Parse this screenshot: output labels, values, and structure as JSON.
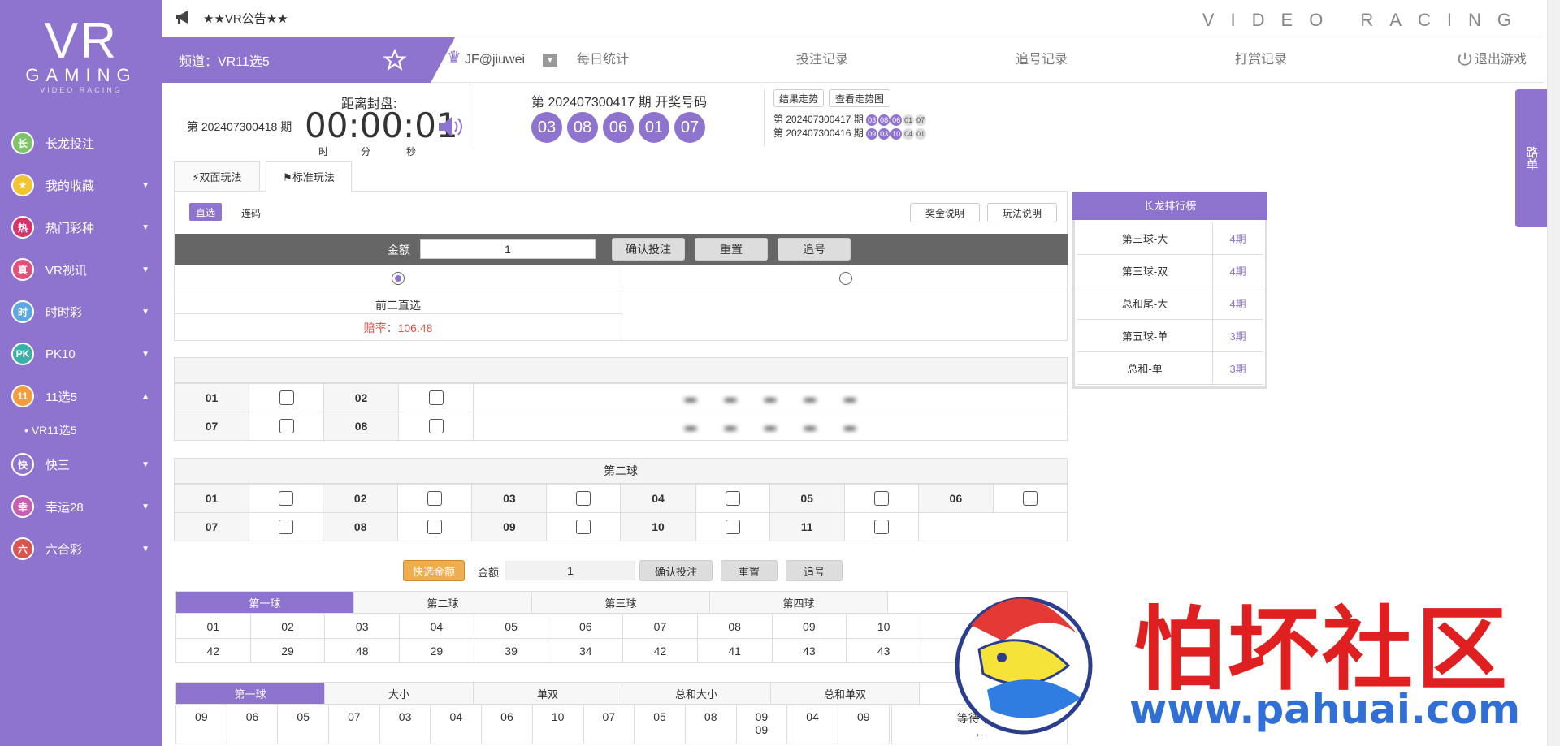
{
  "brand": {
    "logo_main": "VR",
    "logo_sub": "GAMING",
    "logo_tag": "VIDEO RACING",
    "header_right": "VIDEO RACING"
  },
  "announcement": "★★VR公告★★",
  "sidebar": {
    "items": [
      {
        "icon": "长",
        "label": "长龙投注",
        "arrow": "",
        "iconbg": "#7cc36a"
      },
      {
        "icon": "★",
        "label": "我的收藏",
        "arrow": "▼",
        "iconbg": "#f4c430"
      },
      {
        "icon": "热",
        "label": "热门彩种",
        "arrow": "▼",
        "iconbg": "#d6336c"
      },
      {
        "icon": "真",
        "label": "VR视讯",
        "arrow": "▼",
        "iconbg": "#e0507a"
      },
      {
        "icon": "时",
        "label": "时时彩",
        "arrow": "▼",
        "iconbg": "#5aa9e6"
      },
      {
        "icon": "PK",
        "label": "PK10",
        "arrow": "▼",
        "iconbg": "#35b3a6"
      },
      {
        "icon": "11",
        "label": "11选5",
        "arrow": "▲",
        "iconbg": "#f39c3c"
      }
    ],
    "sub_item": "• VR11选5",
    "items2": [
      {
        "icon": "快",
        "label": "快三",
        "arrow": "▼",
        "iconbg": "#8e73cf"
      },
      {
        "icon": "幸",
        "label": "幸运28",
        "arrow": "▼",
        "iconbg": "#c55fb0"
      },
      {
        "icon": "六",
        "label": "六合彩",
        "arrow": "▼",
        "iconbg": "#d9534f"
      }
    ]
  },
  "topbar": {
    "channel": "频道：VR11选5",
    "user": "JF@jiuwei",
    "links": [
      "每日统计",
      "投注记录",
      "追号记录",
      "打赏记录"
    ],
    "logout": "退出游戏"
  },
  "draw": {
    "current_period": "第 202407300418 期",
    "countdown_label": "距离封盘:",
    "countdown": "00:00:01",
    "units": [
      "时",
      "分",
      "秒"
    ],
    "last_label": "第 202407300417 期 开奖号码",
    "last_balls": [
      "03",
      "08",
      "06",
      "01",
      "07"
    ],
    "trend_btn": "结果走势",
    "chart_btn": "查看走势图",
    "history": [
      {
        "period": "第 202407300417 期",
        "balls": [
          "03",
          "08",
          "06",
          "01",
          "07"
        ]
      },
      {
        "period": "第 202407300416 期",
        "balls": [
          "09",
          "03",
          "10",
          "04",
          "01"
        ]
      }
    ]
  },
  "tabs": [
    "⚡双面玩法",
    "⚑标准玩法"
  ],
  "modes": [
    "直选",
    "连码"
  ],
  "help_buttons": [
    "奖金说明",
    "玩法说明"
  ],
  "betbar": {
    "amount_label": "金额",
    "amount": "1",
    "confirm": "确认投注",
    "reset": "重置",
    "chase": "追号"
  },
  "option": {
    "name": "前二直选",
    "odds": "赔率：106.48"
  },
  "ball_nums_row1": [
    "01",
    "02"
  ],
  "ball_nums_row2": [
    "07",
    "08"
  ],
  "second_ball": {
    "title": "第二球",
    "row1": [
      "01",
      "02",
      "03",
      "04",
      "05",
      "06"
    ],
    "row2": [
      "07",
      "08",
      "09",
      "10",
      "11"
    ]
  },
  "betbar2": {
    "quick": "快选金额",
    "amount_label": "金额",
    "amount": "1",
    "confirm": "确认投注",
    "reset": "重置",
    "chase": "追号"
  },
  "stats": {
    "tabs": [
      "第一球",
      "第二球",
      "第三球",
      "第四球"
    ],
    "nums": [
      "01",
      "02",
      "03",
      "04",
      "05",
      "06",
      "07",
      "08",
      "09",
      "10"
    ],
    "counts": [
      "42",
      "29",
      "48",
      "29",
      "39",
      "34",
      "42",
      "41",
      "43",
      "43"
    ]
  },
  "road": {
    "tabs": [
      "第一球",
      "大小",
      "单双",
      "总和大小",
      "总和单双"
    ],
    "row1": [
      "09",
      "06",
      "05",
      "07",
      "03",
      "04",
      "06",
      "10",
      "07",
      "05",
      "08",
      "09",
      "04",
      "09"
    ],
    "row1b": "09",
    "waiting": "等待下期",
    "arrow": "←"
  },
  "rank": {
    "title": "长龙排行榜",
    "rows": [
      {
        "name": "第三球-大",
        "val": "4期"
      },
      {
        "name": "第三球-双",
        "val": "4期"
      },
      {
        "name": "总和尾-大",
        "val": "4期"
      },
      {
        "name": "第五球-单",
        "val": "3期"
      },
      {
        "name": "总和-单",
        "val": "3期"
      }
    ]
  },
  "road_tab": "路单",
  "watermark": {
    "title": "怕坏社区",
    "url": "www.pahuai.com"
  }
}
